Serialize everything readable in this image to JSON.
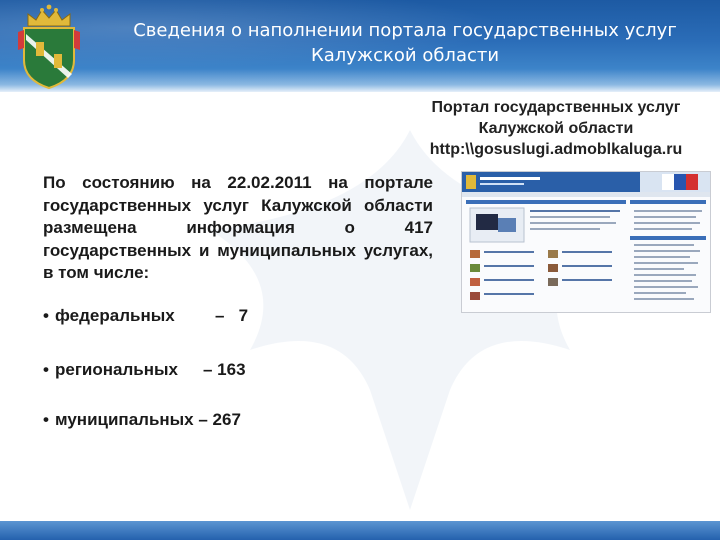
{
  "header": {
    "title_line1": "Сведения о наполнении портала государственных услуг",
    "title_line2": "Калужской области",
    "emblem_icon": "kaluga-coat-of-arms-icon"
  },
  "portal": {
    "line1": "Портал государственных услуг",
    "line2": "Калужской области",
    "line3": "http:\\\\gosuslugi.admoblkaluga.ru"
  },
  "intro": "По состоянию на 22.02.2011 на портале государственных услуг Калужской области размещена информация о 417 государственных и муниципальных услугах, в том числе:",
  "bullets": [
    {
      "label": "федеральных",
      "value": "–   7"
    },
    {
      "label": "региональных",
      "value": "– 163"
    },
    {
      "label": "муниципальных – 267",
      "value": ""
    }
  ],
  "colors": {
    "header": "#2b6db8",
    "accent": "#1d5aa3"
  }
}
